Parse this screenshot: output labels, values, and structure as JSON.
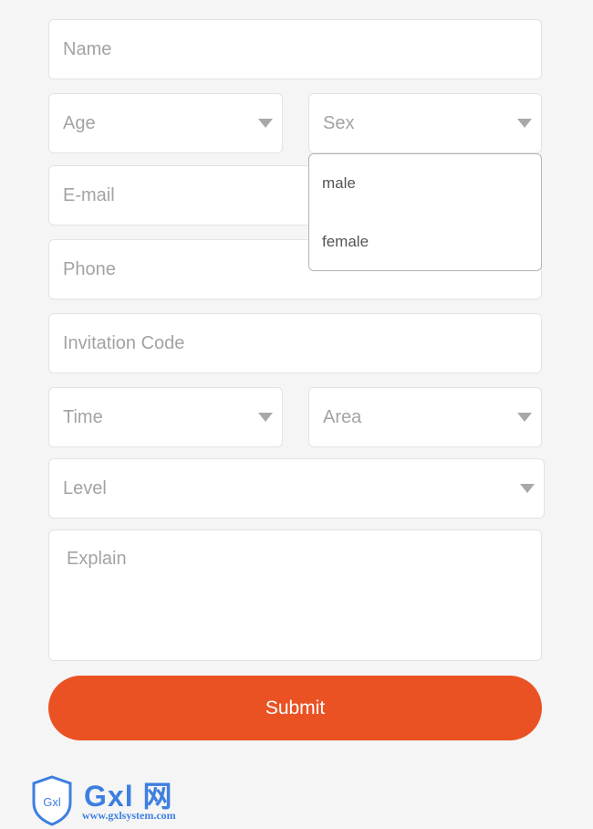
{
  "form": {
    "name_placeholder": "Name",
    "age_placeholder": "Age",
    "sex_placeholder": "Sex",
    "email_placeholder": "E-mail",
    "phone_placeholder": "Phone",
    "invitation_placeholder": "Invitation Code",
    "time_placeholder": "Time",
    "area_placeholder": "Area",
    "level_placeholder": "Level",
    "explain_placeholder": "Explain",
    "submit_label": "Submit"
  },
  "sex_dropdown": {
    "options": [
      "male",
      "female"
    ]
  },
  "logo": {
    "shield_text": "Gxl",
    "name": "Gxl 网",
    "url": "www.gxlsystem.com"
  },
  "colors": {
    "accent": "#ea5224",
    "logo": "#3e7fe0"
  }
}
